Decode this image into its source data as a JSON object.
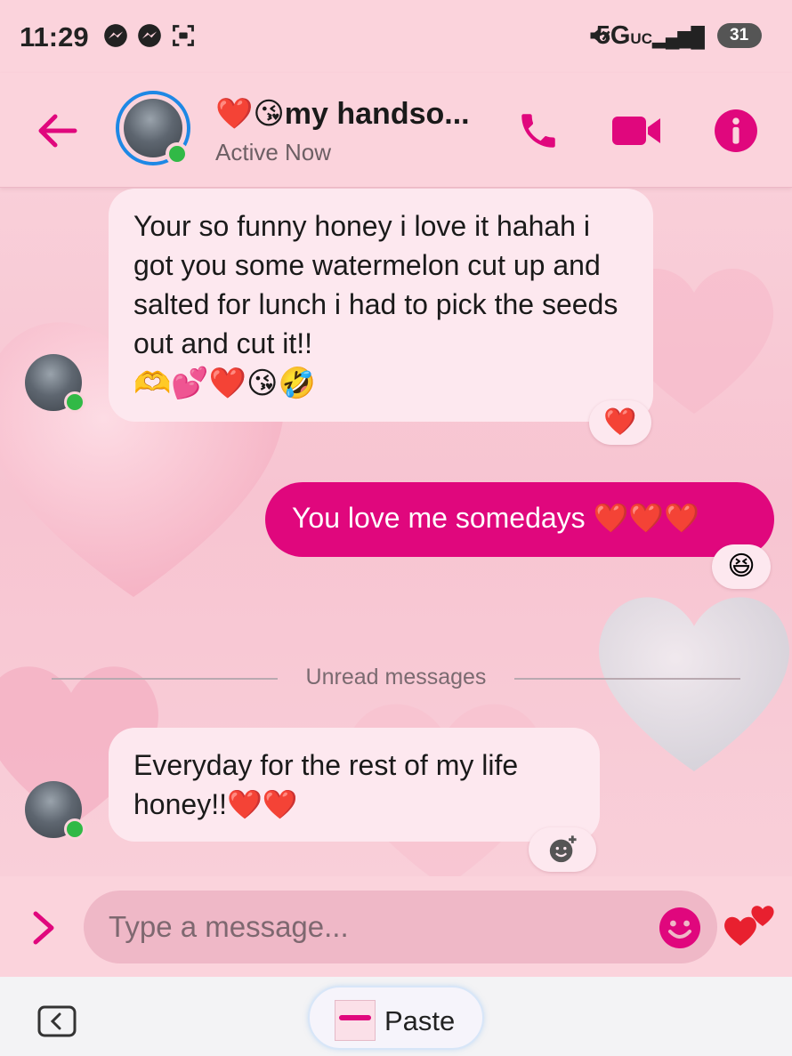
{
  "status_bar": {
    "time": "11:29",
    "network": "5G",
    "network_suffix": "UC",
    "battery": "31"
  },
  "header": {
    "title_emoji": "❤️😘",
    "title": "my handso...",
    "status": "Active Now"
  },
  "messages": [
    {
      "direction": "incoming",
      "text": "Your so funny honey i love it hahah i got you some watermelon cut up and salted for lunch i had to pick the seeds out and cut it!!",
      "trailing_emoji": "🫶💕❤️😘🤣",
      "reaction": "❤️"
    },
    {
      "direction": "outgoing",
      "text": "You love me somedays ",
      "trailing_emoji": "❤️❤️❤️",
      "reaction": "😆"
    },
    {
      "direction": "incoming",
      "text": "Everyday for the rest of my life honey!!",
      "trailing_emoji": "❤️❤️",
      "reaction": "add-reaction-icon"
    }
  ],
  "divider_label": "Unread messages",
  "composer": {
    "placeholder": "Type a message..."
  },
  "keyboard_bar": {
    "paste_label": "Paste"
  },
  "colors": {
    "accent": "#e0077d",
    "background": "#fbd3dc",
    "incoming_bubble": "#fde8ef",
    "online": "#31b946",
    "story_ring": "#1e88e5"
  }
}
